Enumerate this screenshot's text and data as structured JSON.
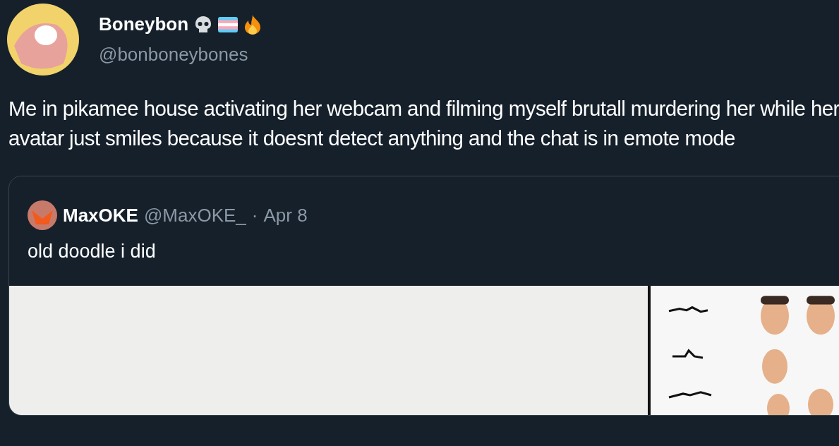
{
  "tweet": {
    "author": {
      "name": "Boneybon",
      "handle": "@bonboneybones"
    },
    "text": "Me in pikamee house activating her webcam and filming myself brutall murdering her while her avatar just smiles because it doesnt detect anything and the chat is in emote mode"
  },
  "quoted_tweet": {
    "author": {
      "name": "MaxOKE",
      "handle": "@MaxOKE_"
    },
    "separator": "·",
    "time": "Apr 8",
    "text": "old doodle i did"
  }
}
